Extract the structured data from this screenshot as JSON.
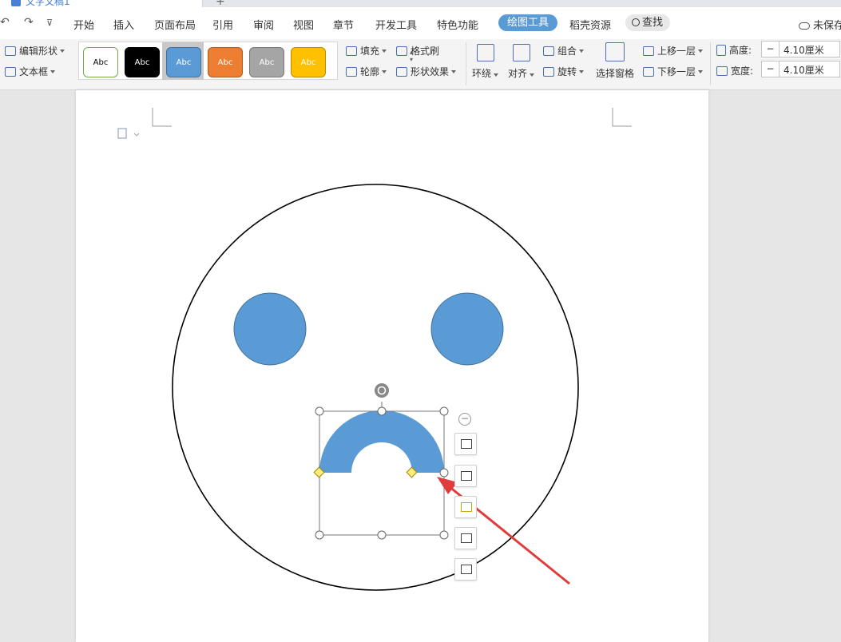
{
  "window": {
    "tab_title": "文字文稿1",
    "new_tab": "+"
  },
  "quick_access": {
    "undo": "↶",
    "redo": "↷",
    "more": "⊽"
  },
  "menu": {
    "items": [
      "开始",
      "插入",
      "页面布局",
      "引用",
      "审阅",
      "视图",
      "章节",
      "开发工具",
      "特色功能"
    ],
    "active": "绘图工具",
    "after_active": "稻壳资源",
    "search": "查找",
    "unsaved": "未保存"
  },
  "ribbon": {
    "edit_shape": "编辑形状",
    "text_box": "文本框",
    "styles": [
      {
        "label": "Abc",
        "bg": "#ffffff",
        "border": "#70ad47",
        "color": "#000000"
      },
      {
        "label": "Abc",
        "bg": "#000000",
        "border": "#000000",
        "color": "#ffffff"
      },
      {
        "label": "Abc",
        "bg": "#5b9bd5",
        "border": "#41719c",
        "color": "#ffffff"
      },
      {
        "label": "Abc",
        "bg": "#ed7d31",
        "border": "#ae5a21",
        "color": "#ffffff"
      },
      {
        "label": "Abc",
        "bg": "#a5a5a5",
        "border": "#787878",
        "color": "#ffffff"
      },
      {
        "label": "Abc",
        "bg": "#ffc000",
        "border": "#bc8c00",
        "color": "#ffffff"
      }
    ],
    "fill": "填充",
    "format_painter": "格式刷",
    "outline": "轮廓",
    "shape_effects": "形状效果",
    "wrap": "环绕",
    "align": "对齐",
    "group": "组合",
    "rotate": "旋转",
    "selection_pane": "选择窗格",
    "bring_forward": "上移一层",
    "send_backward": "下移一层",
    "height_label": "高度:",
    "height_value": "4.10厘米",
    "width_label": "宽度:",
    "width_value": "4.10厘米",
    "minus": "−"
  },
  "canvas": {
    "face_stroke": "#000000",
    "eye_fill": "#5b9bd5",
    "eye_stroke": "#41719c",
    "mouth_fill": "#5b9bd5",
    "arrow_color": "#e03c3c",
    "handle_yellow": "#ffeb7a"
  },
  "float_tools": {
    "collapse": "−"
  }
}
